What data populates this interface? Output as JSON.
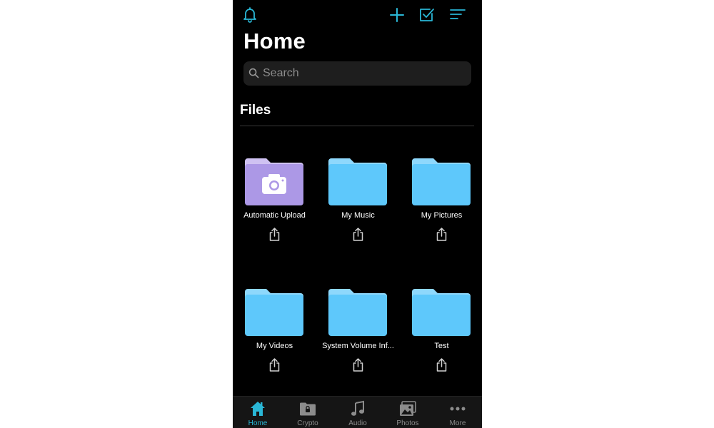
{
  "colors": {
    "accent": "#2ab7d6",
    "folder_blue": "#5ec8fb",
    "folder_blue_tab": "#8ed8fc",
    "folder_purple": "#ac98e6",
    "folder_purple_tab": "#cfc2f2",
    "background": "#000000",
    "tab_inactive": "#8c8c8c"
  },
  "header": {
    "icons": [
      "bell-icon",
      "plus-icon",
      "select-checkbox-icon",
      "sort-lines-icon"
    ]
  },
  "page": {
    "title": "Home"
  },
  "search": {
    "placeholder": "Search"
  },
  "files": {
    "section_title": "Files",
    "items": [
      {
        "name": "Automatic Upload",
        "icon": "camera-folder-icon"
      },
      {
        "name": "My Music",
        "icon": "folder-icon"
      },
      {
        "name": "My Pictures",
        "icon": "folder-icon"
      },
      {
        "name": "My Videos",
        "icon": "folder-icon"
      },
      {
        "name": "System Volume Inf...",
        "icon": "folder-icon"
      },
      {
        "name": "Test",
        "icon": "folder-icon"
      }
    ],
    "share_icon": "share-icon"
  },
  "tabbar": {
    "tabs": [
      {
        "label": "Home",
        "icon": "home-icon",
        "active": true
      },
      {
        "label": "Crypto",
        "icon": "lock-folder-icon",
        "active": false
      },
      {
        "label": "Audio",
        "icon": "music-note-icon",
        "active": false
      },
      {
        "label": "Photos",
        "icon": "photos-icon",
        "active": false
      },
      {
        "label": "More",
        "icon": "ellipsis-icon",
        "active": false
      }
    ]
  }
}
